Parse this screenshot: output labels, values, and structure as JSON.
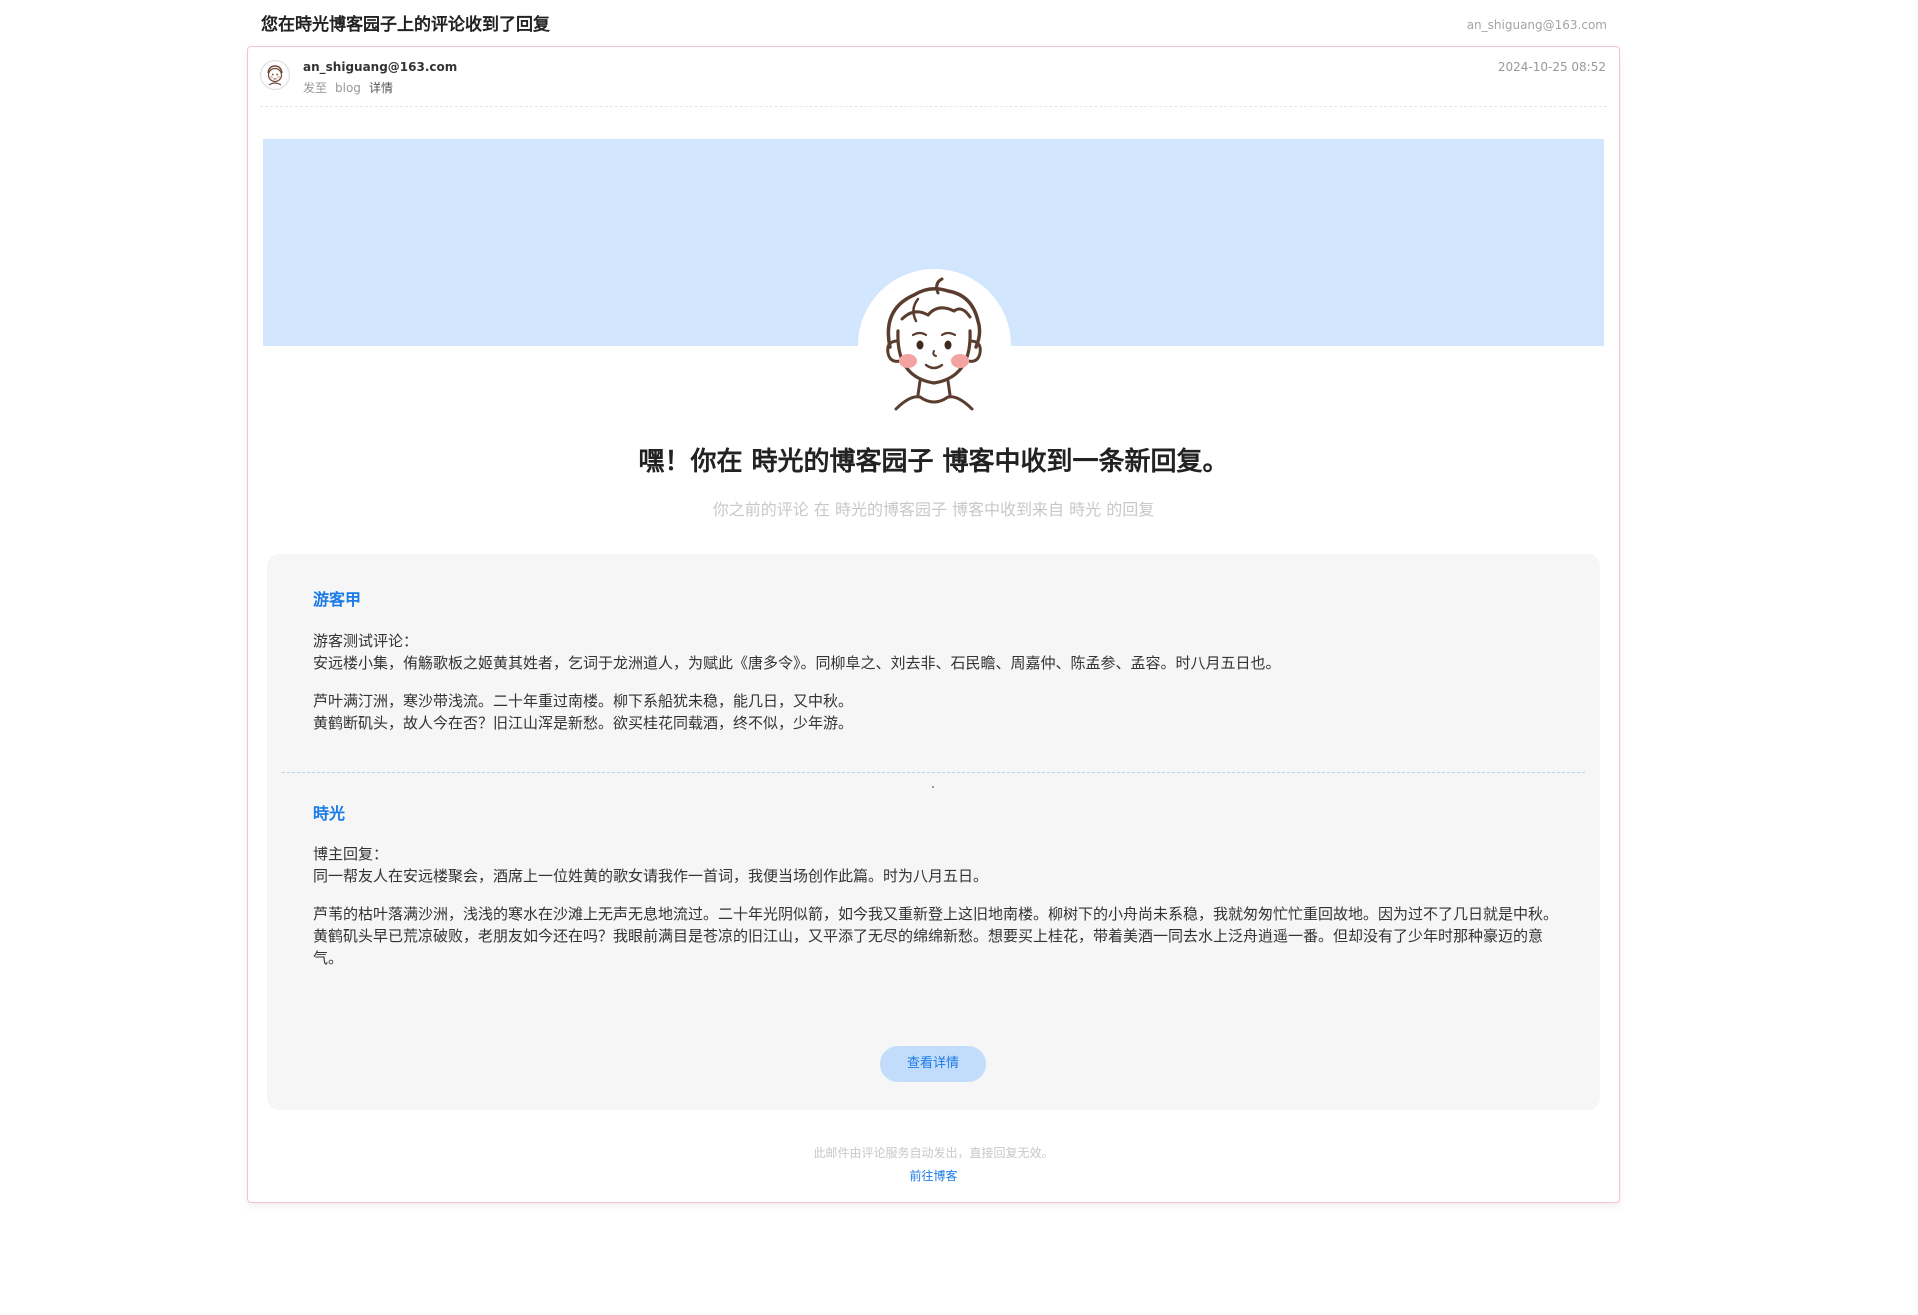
{
  "email": {
    "subject": "您在時光博客园子上的评论收到了回复",
    "recipient": "an_shiguang@163.com",
    "sender": {
      "address": "an_shiguang@163.com",
      "to_label": "发至",
      "to_value": "blog",
      "detail_label": "详情"
    },
    "send_time": "2024-10-25 08:52"
  },
  "content": {
    "headline": "嘿！你在 時光的博客园子 博客中收到一条新回复。",
    "subline": "你之前的评论 在 時光的博客园子 博客中收到来自 時光 的回复"
  },
  "comment": {
    "author": "游客甲",
    "lines": [
      "游客测试评论：",
      "安远楼小集，侑觞歌板之姬黄其姓者，乞词于龙洲道人，为赋此《唐多令》。同柳阜之、刘去非、石民瞻、周嘉仲、陈孟参、孟容。时八月五日也。"
    ],
    "poem": [
      "芦叶满汀洲，寒沙带浅流。二十年重过南楼。柳下系船犹未稳，能几日，又中秋。",
      "黄鹤断矶头，故人今在否？旧江山浑是新愁。欲买桂花同载酒，终不似，少年游。"
    ]
  },
  "reply": {
    "author": "時光",
    "lines": [
      "博主回复：",
      "同一帮友人在安远楼聚会，酒席上一位姓黄的歌女请我作一首词，我便当场创作此篇。时为八月五日。"
    ],
    "translation": [
      "芦苇的枯叶落满沙洲，浅浅的寒水在沙滩上无声无息地流过。二十年光阴似箭，如今我又重新登上这旧地南楼。柳树下的小舟尚未系稳，我就匆匆忙忙重回故地。因为过不了几日就是中秋。",
      "黄鹤矶头早已荒凉破败，老朋友如今还在吗？我眼前满目是苍凉的旧江山，又平添了无尽的绵绵新愁。想要买上桂花，带着美酒一同去水上泛舟逍遥一番。但却没有了少年时那种豪迈的意气。"
    ]
  },
  "actions": {
    "view_detail": "查看详情"
  },
  "footer": {
    "note": "此邮件由评论服务自动发出，直接回复无效。",
    "link": "前往博客"
  },
  "colors": {
    "banner": "#d2e6fe",
    "accent": "#1a7ae8",
    "button_bg": "#c2dcfb",
    "card_border": "#f5c3cd",
    "box_bg": "#f6f6f6"
  },
  "icons": {
    "sender_avatar": "cartoon-boy-avatar-icon",
    "hero_avatar": "cartoon-boy-avatar-icon"
  }
}
